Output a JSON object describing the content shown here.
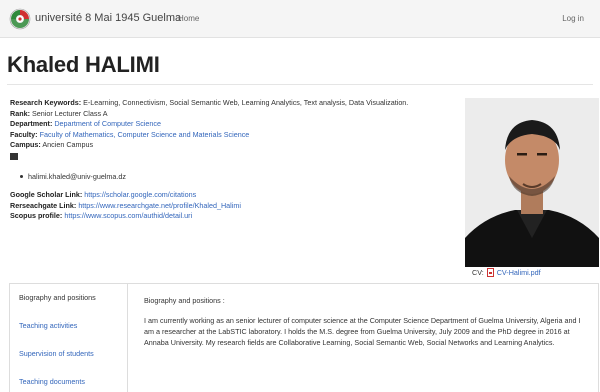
{
  "navbar": {
    "brand": "université 8 Mai 1945 Guelma",
    "home": "Home",
    "login": "Log in"
  },
  "profile": {
    "name": "Khaled HALIMI",
    "research_keywords_label": "Research Keywords:",
    "research_keywords": "E-Learning, Connectivism, Social Semantic Web, Learning Analytics, Text analysis, Data Visualization.",
    "rank_label": "Rank:",
    "rank": "Senior Lecturer Class A",
    "department_label": "Department:",
    "department": "Department of Computer Science",
    "faculty_label": "Faculty:",
    "faculty": "Faculty of Mathematics, Computer Science and Materials Science",
    "campus_label": "Campus:",
    "campus": "Ancien Campus",
    "email": "halimi.khaled@univ-guelma.dz",
    "google_scholar_label": "Google Scholar Link:",
    "google_scholar": "https://scholar.google.com/citations",
    "researchgate_label": "Rerseachgate Link:",
    "researchgate": "https://www.researchgate.net/profile/Khaled_Halimi",
    "scopus_label": "Scopus profile:",
    "scopus": "https://www.scopus.com/authid/detail.uri",
    "cv_label": "CV:",
    "cv_file": "CV-Halimi.pdf"
  },
  "tabs": [
    {
      "label": "Biography and positions"
    },
    {
      "label": "Teaching activities"
    },
    {
      "label": "Supervision of students"
    },
    {
      "label": "Teaching documents"
    }
  ],
  "content": {
    "heading": "Biography and positions :",
    "text": "I am currently working as an senior lecturer of computer science at the Computer Science Department of Guelma University, Algeria and I am a researcher at the LabSTIC laboratory. I holds the M.S. degree from Guelma University, July 2009 and the PhD degree in 2016 at Annaba University. My research fields are Collaborative Learning, Social Semantic Web, Social Networks and Learning Analytics."
  }
}
